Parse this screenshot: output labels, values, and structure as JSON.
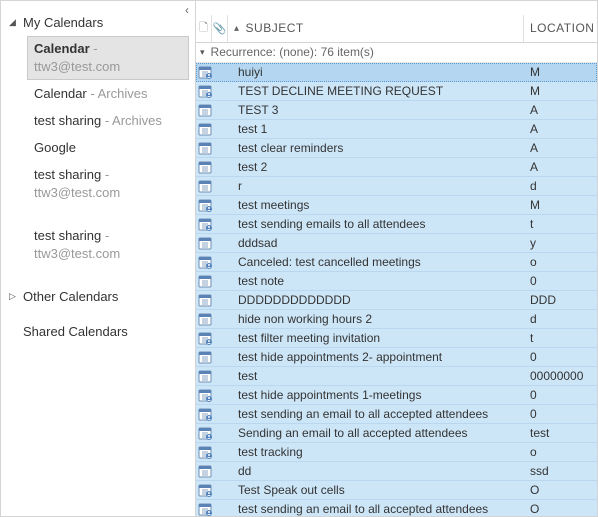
{
  "sidebar": {
    "collapse_glyph": "‹",
    "groups": [
      {
        "label": "My Calendars",
        "expanded": true,
        "items": [
          {
            "name": "Calendar",
            "suffix": " - ttw3@test.com",
            "selected": true
          },
          {
            "name": "Calendar",
            "suffix": " - Archives"
          },
          {
            "name": "test sharing",
            "suffix": " - Archives"
          },
          {
            "name": "Google",
            "suffix": ""
          },
          {
            "name": "test sharing",
            "suffix": " - ttw3@test.com"
          },
          {
            "gap": true
          },
          {
            "name": "test sharing",
            "suffix": " - ttw3@test.com"
          }
        ]
      },
      {
        "label": "Other Calendars",
        "expanded": false,
        "items": []
      },
      {
        "label": "Shared Calendars",
        "expanded": null,
        "items": []
      }
    ]
  },
  "columns": {
    "icon1_glyph": "🗋",
    "icon2_glyph": "📎",
    "subject": "SUBJECT",
    "location": "LOCATION"
  },
  "list_group": {
    "label": "Recurrence: (none): 76 item(s)"
  },
  "rows": [
    {
      "icon": "meeting",
      "subject": "huiyi",
      "location": "M",
      "focused": true
    },
    {
      "icon": "meeting",
      "subject": "TEST DECLINE MEETING REQUEST",
      "location": "M"
    },
    {
      "icon": "appt",
      "subject": "TEST 3",
      "location": "A"
    },
    {
      "icon": "appt",
      "subject": "test 1",
      "location": "A"
    },
    {
      "icon": "appt",
      "subject": "test clear reminders",
      "location": "A"
    },
    {
      "icon": "appt",
      "subject": "test 2",
      "location": "A"
    },
    {
      "icon": "appt",
      "subject": "r",
      "location": "d"
    },
    {
      "icon": "meeting",
      "subject": "test meetings",
      "location": "M"
    },
    {
      "icon": "meeting",
      "subject": "test sending emails to all attendees",
      "location": "t"
    },
    {
      "icon": "appt",
      "subject": "dddsad",
      "location": "y"
    },
    {
      "icon": "meeting",
      "subject": "Canceled: test cancelled meetings",
      "location": "o"
    },
    {
      "icon": "appt",
      "subject": "test note",
      "location": "0"
    },
    {
      "icon": "appt",
      "subject": "DDDDDDDDDDDDD",
      "location": "DDD"
    },
    {
      "icon": "appt",
      "subject": "hide non working hours 2",
      "location": "d"
    },
    {
      "icon": "meeting",
      "subject": "test filter meeting invitation",
      "location": "t"
    },
    {
      "icon": "appt",
      "subject": "test hide appointments 2- appointment",
      "location": "0"
    },
    {
      "icon": "appt",
      "subject": "test",
      "location": "00000000"
    },
    {
      "icon": "meeting",
      "subject": "test hide appointments 1-meetings",
      "location": "0"
    },
    {
      "icon": "meeting",
      "subject": "test sending an email to all accepted attendees",
      "location": "0"
    },
    {
      "icon": "meeting",
      "subject": "Sending an email to all accepted attendees",
      "location": "test"
    },
    {
      "icon": "meeting",
      "subject": "test tracking",
      "location": "o"
    },
    {
      "icon": "appt",
      "subject": "dd",
      "location": "ssd"
    },
    {
      "icon": "meeting",
      "subject": "Test Speak out cells",
      "location": "O"
    },
    {
      "icon": "meeting",
      "subject": "test sending an email to all accepted attendees",
      "location": "O"
    }
  ]
}
